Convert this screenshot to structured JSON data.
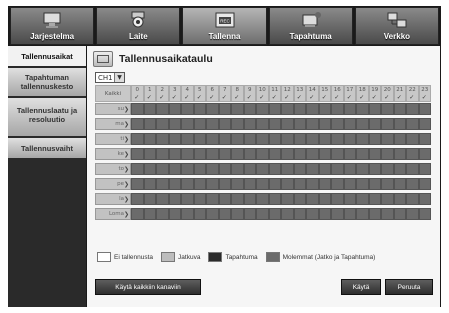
{
  "tabs": [
    {
      "label": "Jarjestelma",
      "icon": "monitor-icon"
    },
    {
      "label": "Laite",
      "icon": "camera-icon"
    },
    {
      "label": "Tallenna",
      "icon": "record-icon",
      "active": true,
      "badge": "REC"
    },
    {
      "label": "Tapahtuma",
      "icon": "event-icon"
    },
    {
      "label": "Verkko",
      "icon": "network-icon"
    }
  ],
  "sidebar": {
    "items": [
      {
        "label": "Tallennusaikat",
        "active": true
      },
      {
        "label": "Tapahtuman tallennuskesto"
      },
      {
        "label": "Tallennuslaatu ja resoluutio"
      },
      {
        "label": "Tallennusvaiht"
      }
    ]
  },
  "main": {
    "title": "Tallennusaikataulu",
    "channel": "CH1",
    "grid": {
      "corner_label": "Kaikki",
      "hours": [
        "0",
        "1",
        "2",
        "3",
        "4",
        "5",
        "6",
        "7",
        "8",
        "9",
        "10",
        "11",
        "12",
        "13",
        "14",
        "15",
        "16",
        "17",
        "18",
        "19",
        "20",
        "21",
        "22",
        "23"
      ],
      "days": [
        "su",
        "ma",
        "ti",
        "ke",
        "to",
        "pe",
        "la",
        "Loma"
      ]
    },
    "legend": [
      {
        "label": "Ei tallennusta",
        "color": "#ffffff"
      },
      {
        "label": "Jatkuva",
        "color": "#bdbdbd"
      },
      {
        "label": "Tapahtuma",
        "color": "#2b2b2b"
      },
      {
        "label": "Molemmat (Jatko ja Tapahtuma)",
        "color": "#6b6b6b"
      }
    ],
    "buttons": {
      "apply_all": "Käytä kaikkiin kanaviin",
      "apply": "Käytä",
      "cancel": "Peruuta"
    }
  }
}
